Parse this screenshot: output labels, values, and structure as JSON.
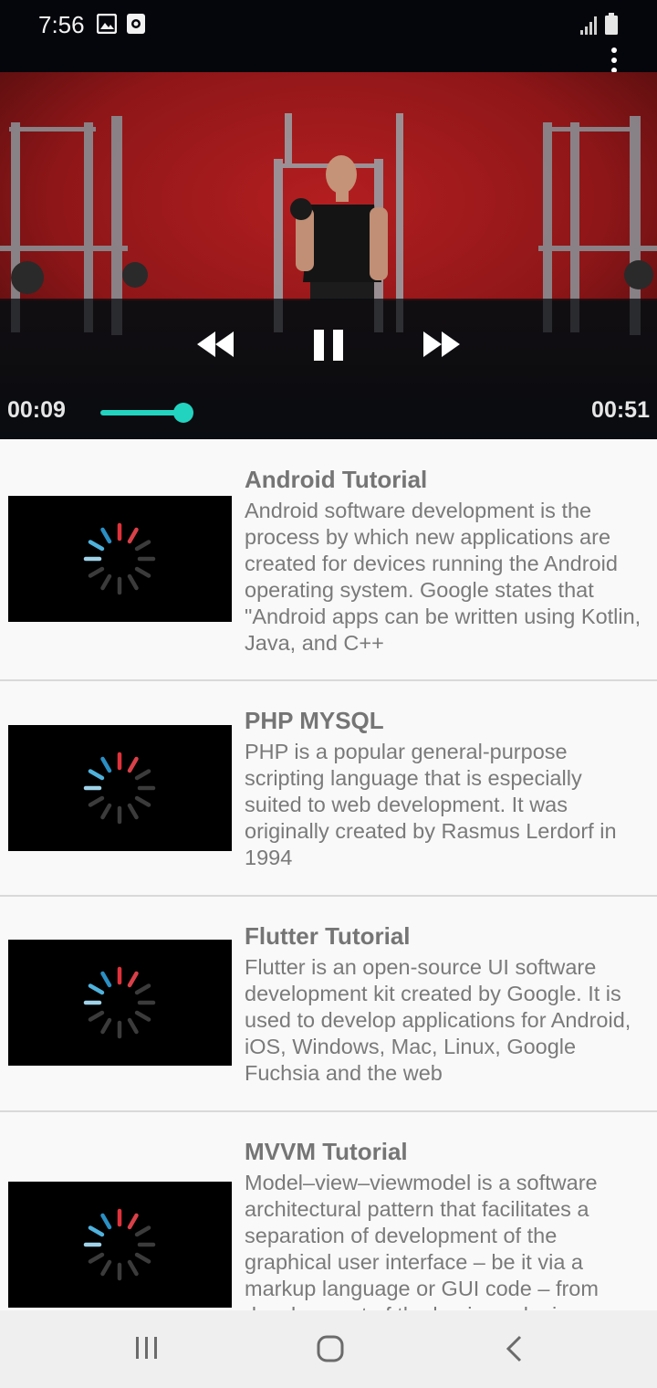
{
  "status_bar": {
    "time": "7:56",
    "left_icons": [
      "gallery-icon",
      "camera-record-icon"
    ],
    "right_icons": [
      "signal-icon",
      "battery-icon"
    ]
  },
  "action_bar": {
    "overflow_icon": "more-vert-icon"
  },
  "player": {
    "current_time": "00:09",
    "total_time": "00:51",
    "progress_fraction": 0.18,
    "accent_color": "#22d3c0",
    "controls": [
      "rewind-icon",
      "pause-icon",
      "fast-forward-icon"
    ]
  },
  "videos": [
    {
      "title": "Android Tutorial",
      "description": "Android software development is the process by which new applications are created for devices running the Android operating system. Google states that \"Android apps can be written using Kotlin, Java, and C++"
    },
    {
      "title": "PHP MYSQL",
      "description": "PHP is a popular general-purpose scripting language that is especially suited to web development. It was originally created by Rasmus Lerdorf in 1994"
    },
    {
      "title": "Flutter Tutorial",
      "description": "Flutter is an open-source UI software development kit created by Google. It is used to develop applications for Android, iOS, Windows, Mac, Linux, Google Fuchsia and the web"
    },
    {
      "title": "MVVM Tutorial",
      "description": "Model–view–viewmodel is a software architectural pattern that facilitates a separation of development of the graphical user interface – be it via a markup language or GUI code – from development of the business logic"
    }
  ],
  "nav_bar": {
    "icons": [
      "recents-icon",
      "home-icon",
      "back-icon"
    ]
  }
}
